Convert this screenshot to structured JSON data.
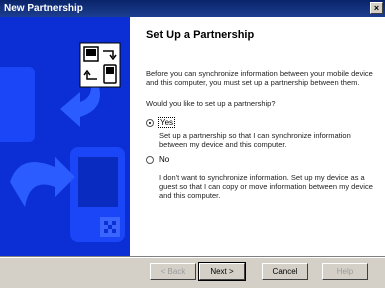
{
  "window": {
    "title": "New Partnership",
    "close_glyph": "×"
  },
  "content": {
    "heading": "Set Up a Partnership",
    "intro": "Before you can synchronize information between your mobile device and this computer, you must set up a partnership between them.",
    "question": "Would you like to set up a partnership?",
    "options": [
      {
        "label": "Yes",
        "selected": true,
        "description": "Set up a partnership so that I can synchronize information between my device and this computer."
      },
      {
        "label": "No",
        "selected": false,
        "description": "I don't want to synchronize information. Set up my device as a guest so that I can copy or move information between my device and this computer."
      }
    ]
  },
  "buttons": {
    "back": "< Back",
    "next": "Next >",
    "cancel": "Cancel",
    "help": "Help"
  },
  "colors": {
    "titlebar": "#0a246a",
    "art_bg": "#0b2fd4",
    "art_light": "#3a66ff"
  }
}
